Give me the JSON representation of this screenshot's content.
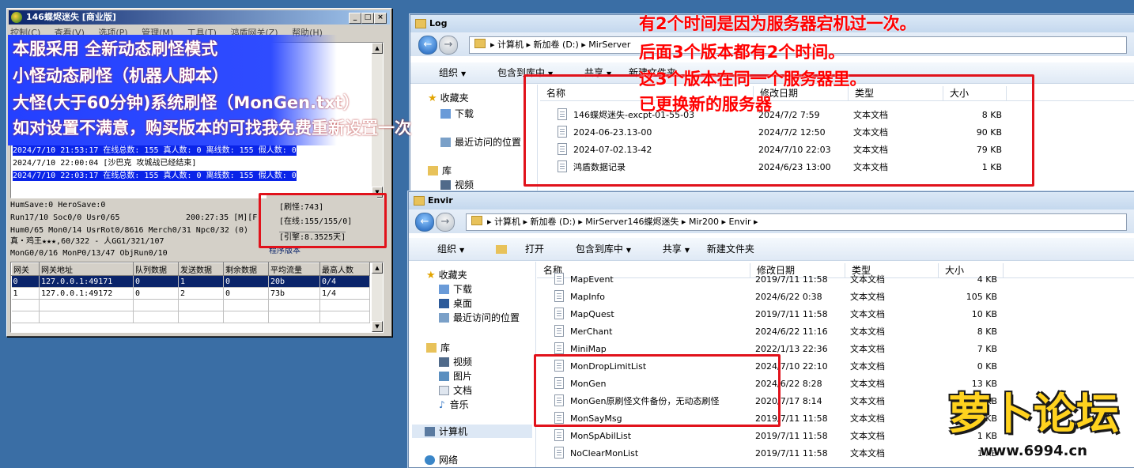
{
  "server": {
    "title": "146蝶烬迷失 [商业版]",
    "menu": [
      "控制(C)",
      "查看(V)",
      "选项(P)",
      "管理(M)",
      "工具(T)",
      "鸿盾网关(Z)",
      "帮助(H)"
    ],
    "log_lines": [
      "2024/7/10 21:53:17 在线总数: 155 真人数: 0 离线数: 155 假人数: 0",
      "2024/7/10 22:00:04 [沙巴克 攻城战已经结束]",
      "2024/7/10 22:03:17 在线总数: 155 真人数: 0 离线数: 155 假人数: 0"
    ],
    "stats": [
      "HumSave:0 HeroSave:0",
      "Run17/10 Soc0/0 Usr0/65",
      "Hum0/65 Mon0/14 UsrRot0/8616 Merch0/31 Npc0/32 (0)",
      "真・鸡王★★★,60/322 - 人GG1/321/107",
      "MonG0/0/16 MonP0/13/47 ObjRun0/10"
    ],
    "clock": "200:27:35 [M][F]",
    "info_box": [
      "[刷怪:743]",
      "[在线:155/155/0]",
      "[引擎:8.3525天]"
    ],
    "program_label": "程序版本",
    "grid_headers": [
      "网关",
      "网关地址",
      "队列数据",
      "发送数据",
      "剩余数据",
      "平均流量",
      "最高人数"
    ],
    "grid_rows": [
      [
        "0",
        "127.0.0.1:49171",
        "0",
        "1",
        "0",
        "20b",
        "0/4"
      ],
      [
        "1",
        "127.0.0.1:49172",
        "0",
        "2",
        "0",
        "73b",
        "1/4"
      ]
    ]
  },
  "log_window": {
    "title": "Log",
    "path": "▸ 计算机 ▸ 新加卷 (D:) ▸ MirServer",
    "toolbar": [
      "组织",
      "包含到库中",
      "共享",
      "新建文件夹"
    ],
    "nav": [
      "收藏夹",
      "下载",
      "最近访问的位置",
      "库",
      "视频"
    ],
    "headers": [
      "名称",
      "修改日期",
      "类型",
      "大小"
    ],
    "files": [
      {
        "name": "146蝶烬迷失-excpt-01-55-03",
        "date": "2024/7/2 7:59",
        "type": "文本文档",
        "size": "8 KB"
      },
      {
        "name": "2024-06-23.13-00",
        "date": "2024/7/2 12:50",
        "type": "文本文档",
        "size": "90 KB"
      },
      {
        "name": "2024-07-02.13-42",
        "date": "2024/7/10 22:03",
        "type": "文本文档",
        "size": "79 KB"
      },
      {
        "name": "鸿盾数据记录",
        "date": "2024/6/23 13:00",
        "type": "文本文档",
        "size": "1 KB"
      }
    ]
  },
  "envir_window": {
    "title": "Envir",
    "path": "▸ 计算机 ▸ 新加卷 (D:) ▸ MirServer146蝶烬迷失 ▸ Mir200 ▸ Envir ▸",
    "toolbar": [
      "组织",
      "打开",
      "包含到库中",
      "共享",
      "新建文件夹"
    ],
    "nav": [
      "收藏夹",
      "下载",
      "桌面",
      "最近访问的位置",
      "库",
      "视频",
      "图片",
      "文档",
      "音乐",
      "计算机",
      "网络"
    ],
    "headers": [
      "名称",
      "修改日期",
      "类型",
      "大小"
    ],
    "files": [
      {
        "name": "MapEvent",
        "date": "2019/7/11 11:58",
        "type": "文本文档",
        "size": "4 KB"
      },
      {
        "name": "MapInfo",
        "date": "2024/6/22 0:38",
        "type": "文本文档",
        "size": "105 KB"
      },
      {
        "name": "MapQuest",
        "date": "2019/7/11 11:58",
        "type": "文本文档",
        "size": "10 KB"
      },
      {
        "name": "MerChant",
        "date": "2024/6/22 11:16",
        "type": "文本文档",
        "size": "8 KB"
      },
      {
        "name": "MiniMap",
        "date": "2022/1/13 22:36",
        "type": "文本文档",
        "size": "7 KB"
      },
      {
        "name": "MonDropLimitList",
        "date": "2024/7/10 22:10",
        "type": "文本文档",
        "size": "0 KB"
      },
      {
        "name": "MonGen",
        "date": "2024/6/22 8:28",
        "type": "文本文档",
        "size": "13 KB"
      },
      {
        "name": "MonGen原刷怪文件备份，无动态刷怪",
        "date": "2020/7/17 8:14",
        "type": "文本文档",
        "size": "20 KB"
      },
      {
        "name": "MonSayMsg",
        "date": "2019/7/11 11:58",
        "type": "文本文档",
        "size": "1 KB"
      },
      {
        "name": "MonSpAbilList",
        "date": "2019/7/11 11:58",
        "type": "文本文档",
        "size": "1 KB"
      },
      {
        "name": "NoClearMonList",
        "date": "2019/7/11 11:58",
        "type": "文本文档",
        "size": "1 KB"
      }
    ]
  },
  "overlay_left": [
    "本服采用 全新动态刷怪模式",
    "小怪动态刷怪（机器人脚本）",
    "大怪(大于60分钟)系统刷怪（MonGen.txt）",
    "如对设置不满意，购买版本的可找我免费重新设置一次"
  ],
  "overlay_right": [
    "有2个时间是因为服务器宕机过一次。",
    "后面3个版本都有2个时间。",
    "这3个版本在同一个服务器里。",
    "已更换新的服务器"
  ],
  "watermark": {
    "text": "萝卜论坛",
    "url": "www.6994.cn"
  },
  "colors": {
    "desktop": "#3a6ea5",
    "annotation_red": "#e1121b",
    "log_highlight": "#0a24e8"
  }
}
